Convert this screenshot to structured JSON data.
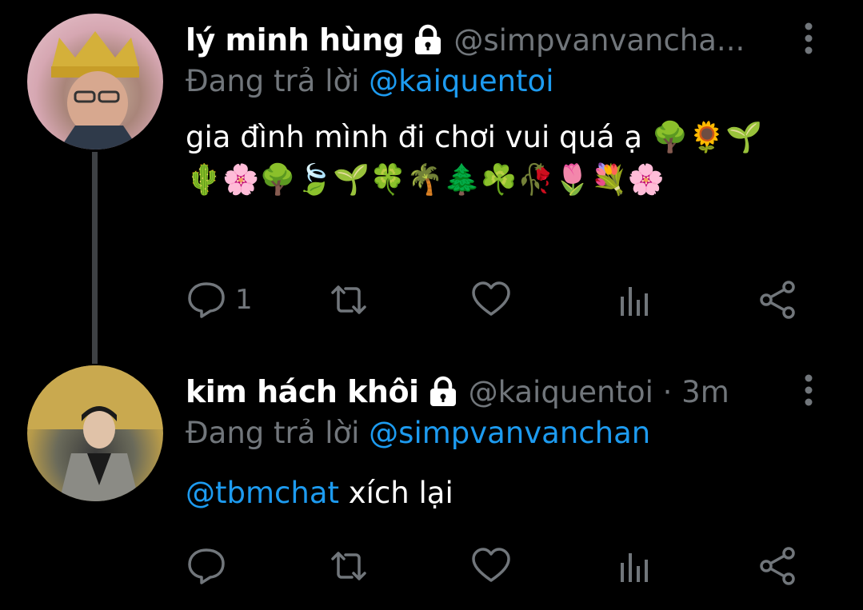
{
  "colors": {
    "background": "#000000",
    "name": "#ffffff",
    "muted": "#71767b",
    "mention": "#1d9bf0",
    "thread_line": "#3e4144"
  },
  "tweets": [
    {
      "display_name": "lý minh hùng",
      "handle_meta": "@simpvanvancha...",
      "reply_prefix": "Đang trả lời",
      "reply_to": "@kaiquentoi",
      "text_prefix": "",
      "text": "gia đình mình đi chơi vui quá ạ 🌳🌻🌱🌵🌸🌳🍃🌱🍀🌴🌲☘️🥀🌷💐🌸",
      "reply_count": "1"
    },
    {
      "display_name": "kim hách khôi",
      "handle_meta": "@kaiquentoi · 3m",
      "reply_prefix": "Đang trả lời",
      "reply_to": "@simpvanvanchan",
      "text_prefix": "@tbmchat",
      "text": " xích lại",
      "reply_count": ""
    }
  ]
}
